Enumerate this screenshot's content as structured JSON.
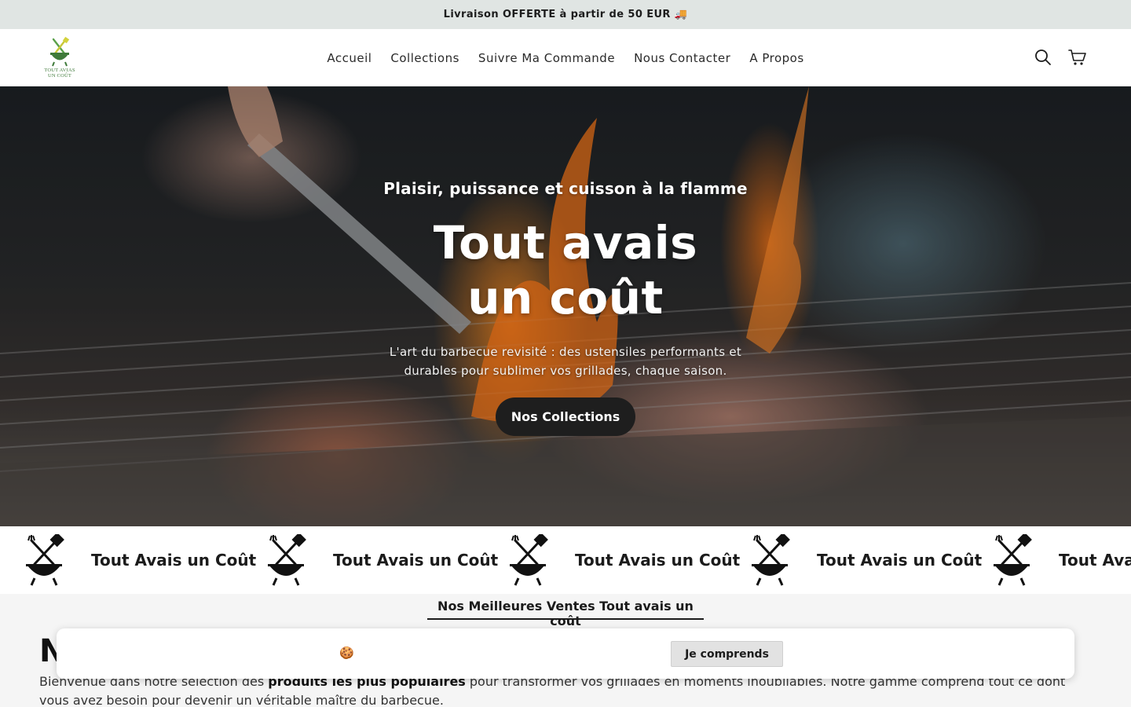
{
  "announcement": {
    "text": "Livraison OFFERTE à partir de 50 EUR 🚚"
  },
  "brand": {
    "logo_line1": "TOUT AVIAS",
    "logo_line2": "UN COÛT",
    "color": "#3f7a3a"
  },
  "nav": {
    "items": [
      {
        "label": "Accueil"
      },
      {
        "label": "Collections"
      },
      {
        "label": "Suivre Ma Commande"
      },
      {
        "label": "Nous Contacter"
      },
      {
        "label": "A Propos"
      }
    ]
  },
  "header_icons": {
    "search": "search-icon",
    "cart": "cart-icon"
  },
  "hero": {
    "eyebrow": "Plaisir, puissance et cuisson à la flamme",
    "title": "Tout avais un coût",
    "subtitle": "L'art du barbecue revisité : des ustensiles performants et durables pour sublimer vos grillades, chaque saison.",
    "button_label": "Nos Collections"
  },
  "marquee": {
    "items": [
      {
        "text": "Tout Avais un Coût",
        "icon": "bbq-grill-icon"
      },
      {
        "text": "Tout Avais un Coût",
        "icon": "bbq-grill-icon"
      },
      {
        "text": "Tout Avais un Coût",
        "icon": "bbq-grill-icon"
      },
      {
        "text": "Tout Avais un Coût",
        "icon": "bbq-grill-icon"
      },
      {
        "text": "Tout Avais un Coût",
        "icon": "bbq-grill-icon"
      }
    ]
  },
  "bestsellers": {
    "tab_label": "Nos Meilleures Ventes Tout avais un coût",
    "heading_visible": "N",
    "intro_before": "Bienvenue dans notre sélection des ",
    "intro_bold": "produits les plus populaires",
    "intro_after": " pour transformer vos grillades en moments inoubliables. Notre gamme comprend tout ce dont vous avez besoin pour devenir un véritable maître du barbecue."
  },
  "cookie_banner": {
    "emoji": "🍪",
    "button_label": "Je comprends"
  },
  "colors": {
    "announcement_bg": "#e0e5e3",
    "button_dark": "#1e1e1e",
    "section_bg": "#f5f5f5"
  }
}
